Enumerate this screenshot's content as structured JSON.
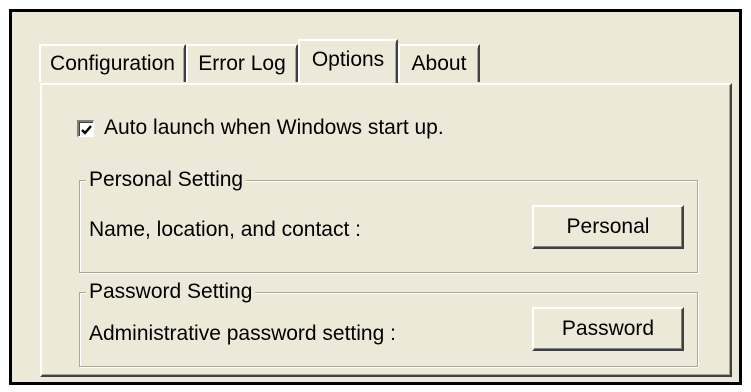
{
  "tabs": [
    {
      "label": "Configuration",
      "active": false
    },
    {
      "label": "Error Log",
      "active": false
    },
    {
      "label": "Options",
      "active": true
    },
    {
      "label": "About",
      "active": false
    }
  ],
  "auto_launch": {
    "label": "Auto launch when Windows start up.",
    "checked": true
  },
  "personal_group": {
    "title": "Personal Setting",
    "description": "Name, location, and contact :",
    "button_label": "Personal"
  },
  "password_group": {
    "title": "Password Setting",
    "description": "Administrative password setting :",
    "button_label": "Password"
  },
  "colors": {
    "face": "#ece9d8",
    "highlight": "#ffffff",
    "shadow": "#404040",
    "group_border": "#aca899"
  }
}
